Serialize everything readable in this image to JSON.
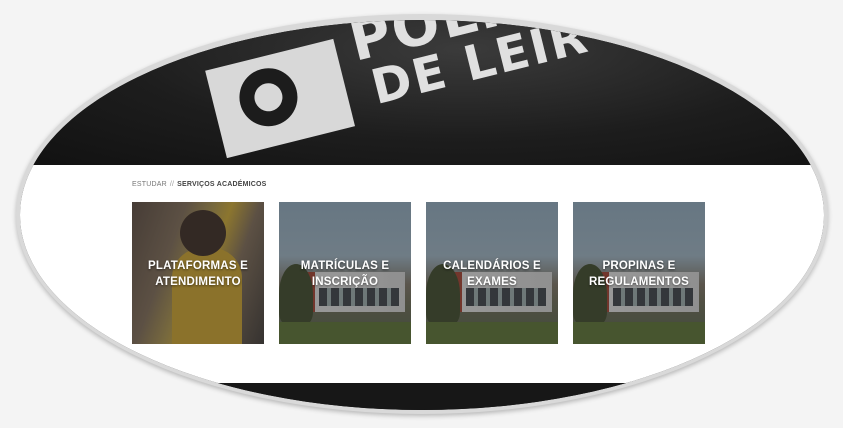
{
  "header": {
    "logo_line1": "POLIT",
    "logo_line2": "DE LEIR"
  },
  "breadcrumb": {
    "parent": "ESTUDAR",
    "separator": "//",
    "current": "SERVIÇOS ACADÉMICOS"
  },
  "cards": [
    {
      "line1": "PLATAFORMAS E",
      "line2": "ATENDIMENTO"
    },
    {
      "line1": "MATRÍCULAS E",
      "line2": "INSCRIÇÃO"
    },
    {
      "line1": "CALENDÁRIOS E",
      "line2": "EXAMES"
    },
    {
      "line1": "PROPINAS E",
      "line2": "REGULAMENTOS"
    }
  ],
  "colors": {
    "header_bg": "#1d1d1d",
    "content_bg": "#ffffff",
    "overlay": "#282828",
    "card_text": "#ffffff"
  }
}
